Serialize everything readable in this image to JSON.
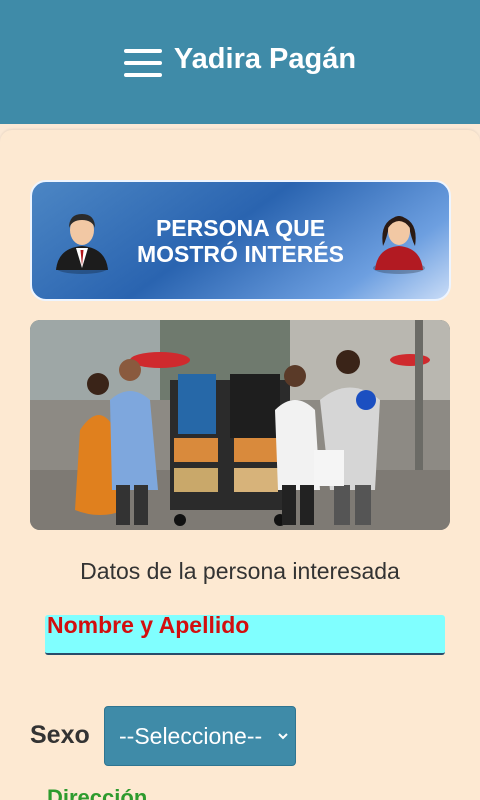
{
  "header": {
    "title": "Yadira Pagán",
    "menu_icon": "hamburger-menu-icon"
  },
  "banner": {
    "line1": "PERSONA QUE",
    "line2": "MOSTRÓ INTERÉS",
    "left_icon": "man-avatar-icon",
    "right_icon": "woman-avatar-icon"
  },
  "photo": {
    "subject": "street-ministry-photo"
  },
  "form": {
    "section_title": "Datos de la persona interesada",
    "name_placeholder": "Nombre y Apellido",
    "sex_label": "Sexo",
    "sex_selected": "--Seleccione--",
    "address_label": "Dirección"
  },
  "colors": {
    "header": "#3f8ba8",
    "background": "#fbe9d6",
    "field": "#80ffff",
    "required_text": "#d20f0f",
    "address_text": "#2e9b2e"
  }
}
